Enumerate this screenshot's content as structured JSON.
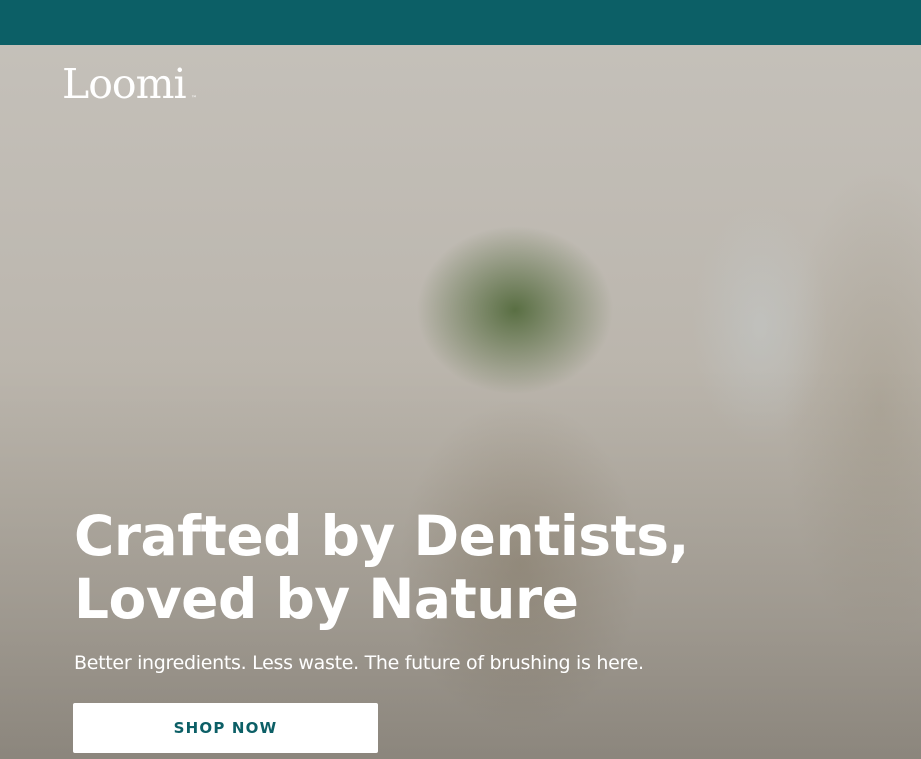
{
  "brand": {
    "logo_text": "Loomi",
    "trademark": "™",
    "primary_color": "#0c5f66"
  },
  "hero": {
    "headline_line1": "Crafted by Dentists,",
    "headline_line2": "Loved by Nature",
    "subheadline": "Better ingredients. Less waste. The future of brushing is here.",
    "cta_label": "SHOP NOW"
  }
}
